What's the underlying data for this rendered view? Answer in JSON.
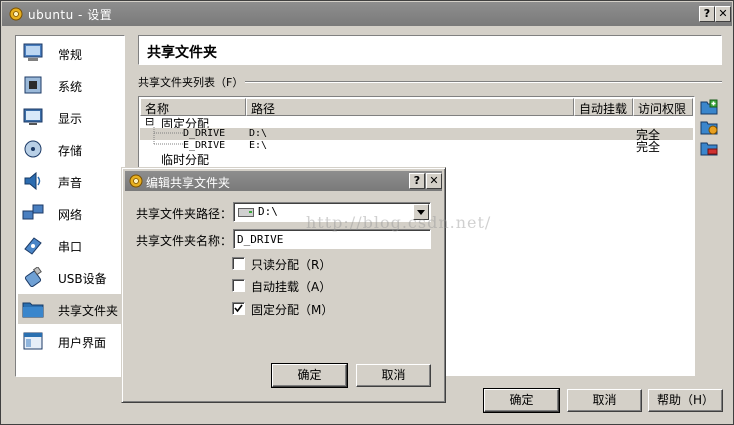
{
  "window": {
    "title": "ubuntu - 设置",
    "help_glyph": "?",
    "close_glyph": "✕"
  },
  "sidebar": {
    "items": [
      {
        "label": "常规",
        "icon": "general-icon"
      },
      {
        "label": "系统",
        "icon": "system-icon"
      },
      {
        "label": "显示",
        "icon": "display-icon"
      },
      {
        "label": "存储",
        "icon": "storage-icon"
      },
      {
        "label": "声音",
        "icon": "audio-icon"
      },
      {
        "label": "网络",
        "icon": "network-icon"
      },
      {
        "label": "串口",
        "icon": "serial-port-icon"
      },
      {
        "label": "USB设备",
        "icon": "usb-icon"
      },
      {
        "label": "共享文件夹",
        "icon": "shared-folder-icon",
        "selected": true
      },
      {
        "label": "用户界面",
        "icon": "user-interface-icon"
      }
    ]
  },
  "panel": {
    "header": "共享文件夹",
    "section_label": "共享文件夹列表（F）",
    "columns": [
      "名称",
      "路径",
      "自动挂载",
      "访问权限"
    ],
    "groups": [
      {
        "label": "固定分配",
        "expander": "⊟",
        "rows": [
          {
            "name": "D_DRIVE",
            "path": "D:\\",
            "auto": "",
            "access": "完全"
          },
          {
            "name": "E_DRIVE",
            "path": "E:\\",
            "auto": "",
            "access": "完全"
          }
        ]
      },
      {
        "label": "临时分配"
      }
    ]
  },
  "buttons": {
    "ok": "确定",
    "cancel": "取消",
    "help": "帮助（H）"
  },
  "dialog": {
    "title": "编辑共享文件夹",
    "help_glyph": "?",
    "close_glyph": "✕",
    "path_label": "共享文件夹路径：",
    "path_value": "D:\\",
    "name_label": "共享文件夹名称：",
    "name_value": "D_DRIVE",
    "checkboxes": [
      {
        "label": "只读分配（R）",
        "checked": false
      },
      {
        "label": "自动挂载（A）",
        "checked": false
      },
      {
        "label": "固定分配（M）",
        "checked": true
      }
    ],
    "ok": "确定",
    "cancel": "取消"
  },
  "watermark": "http://blog.csdn.net/",
  "colors": {
    "title_bar": "#7f7f7f",
    "face": "#d4d0c8",
    "accent_folder": "#2a6fb0"
  }
}
